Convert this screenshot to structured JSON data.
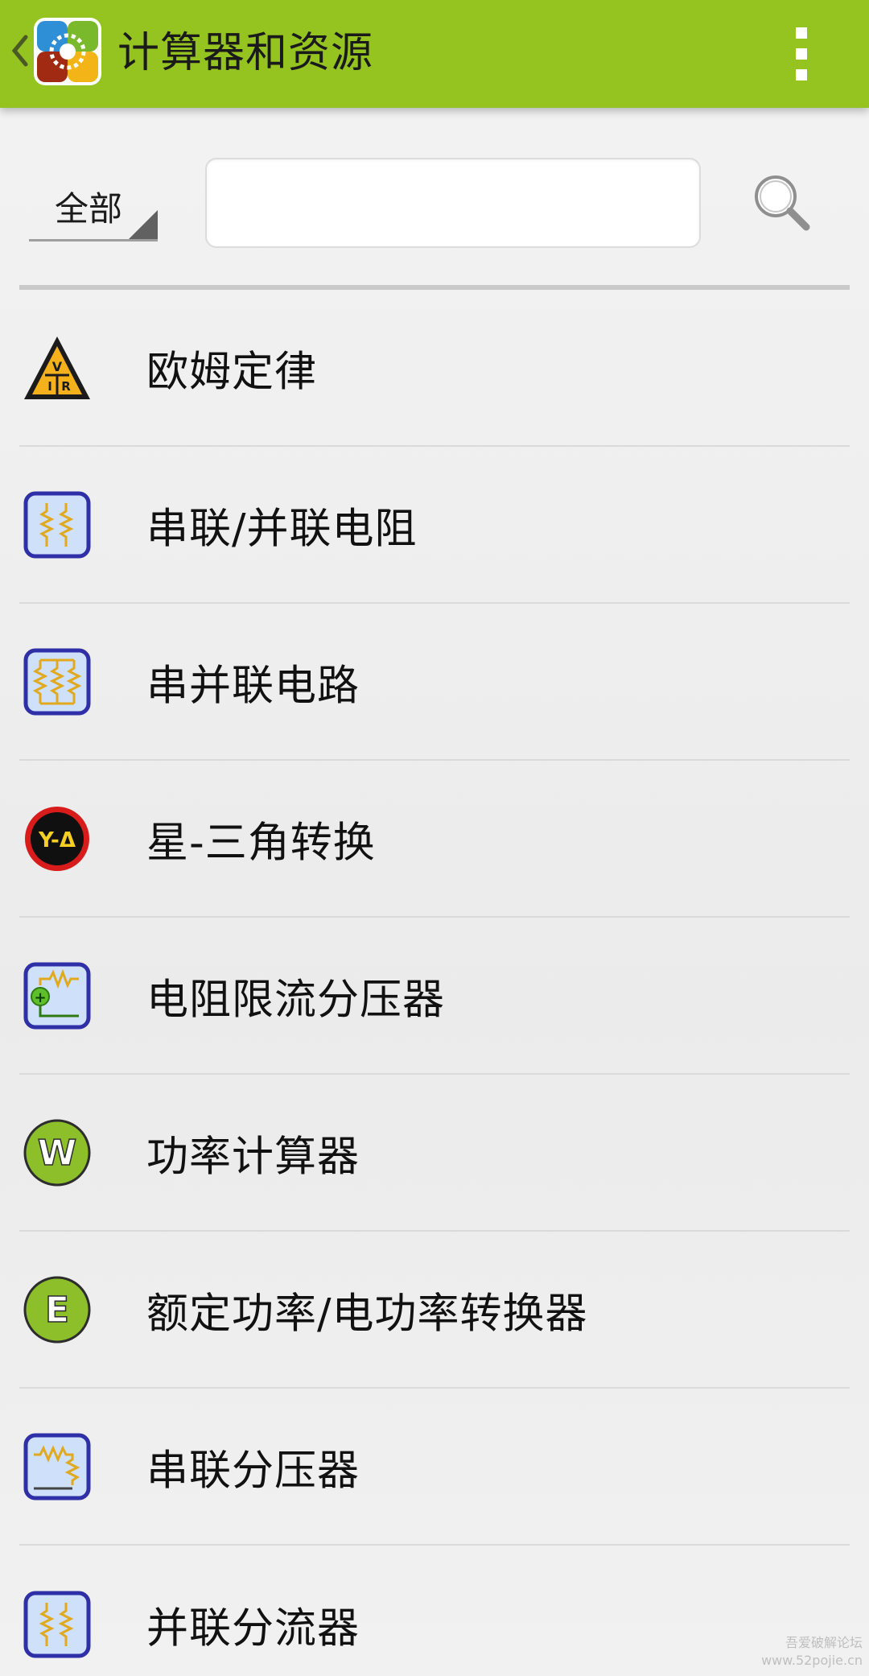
{
  "app_bar": {
    "title": "计算器和资源",
    "colors": {
      "bar": "#95c31f",
      "text": "#1a1a1a"
    }
  },
  "filter": {
    "category_selected": "全部",
    "search_value": "",
    "search_placeholder": ""
  },
  "items": [
    {
      "label": "欧姆定律",
      "icon": "ohms-law-triangle-icon"
    },
    {
      "label": "串联/并联电阻",
      "icon": "series-parallel-resistor-icon"
    },
    {
      "label": "串并联电路",
      "icon": "series-parallel-circuit-icon"
    },
    {
      "label": "星-三角转换",
      "icon": "star-delta-icon",
      "icon_text": "Y-Δ"
    },
    {
      "label": "电阻限流分压器",
      "icon": "current-limit-divider-icon"
    },
    {
      "label": "功率计算器",
      "icon": "power-w-icon",
      "icon_text": "W"
    },
    {
      "label": "额定功率/电功率转换器",
      "icon": "rated-power-e-icon",
      "icon_text": "E"
    },
    {
      "label": "串联分压器",
      "icon": "series-divider-icon"
    },
    {
      "label": "并联分流器",
      "icon": "parallel-divider-icon"
    }
  ],
  "watermark": {
    "line1": "吾爱破解论坛",
    "line2": "www.52pojie.cn"
  },
  "colors": {
    "icon_frame": "#2f2fa8",
    "icon_fill": "#cfe0fb",
    "resistor": "#e0a91e",
    "green_circle": "#8cbf2a",
    "warning": "#f5b11c"
  }
}
